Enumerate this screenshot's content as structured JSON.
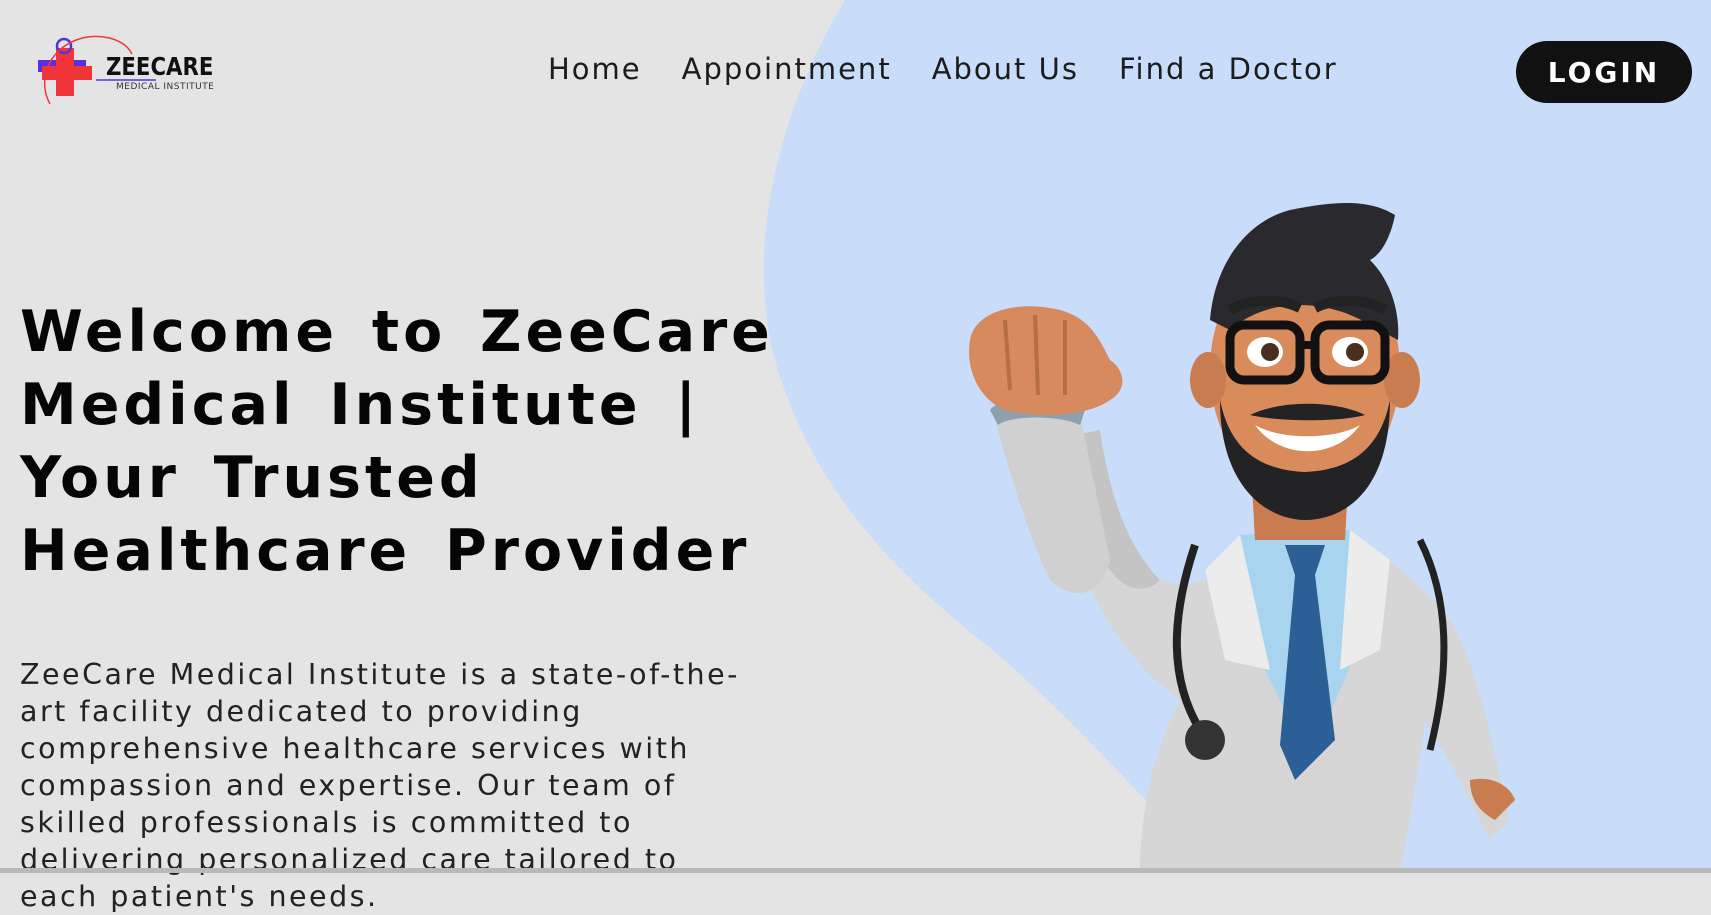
{
  "logo": {
    "name": "ZEECARE",
    "tagline": "MEDICAL INSTITUTE"
  },
  "nav": {
    "links": [
      "Home",
      "Appointment",
      "About Us",
      "Find a Doctor"
    ],
    "login_label": "LOGIN"
  },
  "hero": {
    "title": "Welcome to ZeeCare Medical Institute | Your Trusted Healthcare Provider",
    "description": "ZeeCare Medical Institute is a state-of-the-art facility dedicated to providing comprehensive healthcare services with compassion and expertise. Our team of skilled professionals is committed to delivering personalized care tailored to each patient's needs."
  },
  "colors": {
    "page_background": "#e4e4e4",
    "blob": "#c9dcfa",
    "login_button": "#111111",
    "logo_red": "#f0353a",
    "logo_purple": "#5a2ee0"
  },
  "icons": {
    "logo": "medical-cross-logo",
    "illustration": "cartoon-doctor"
  }
}
